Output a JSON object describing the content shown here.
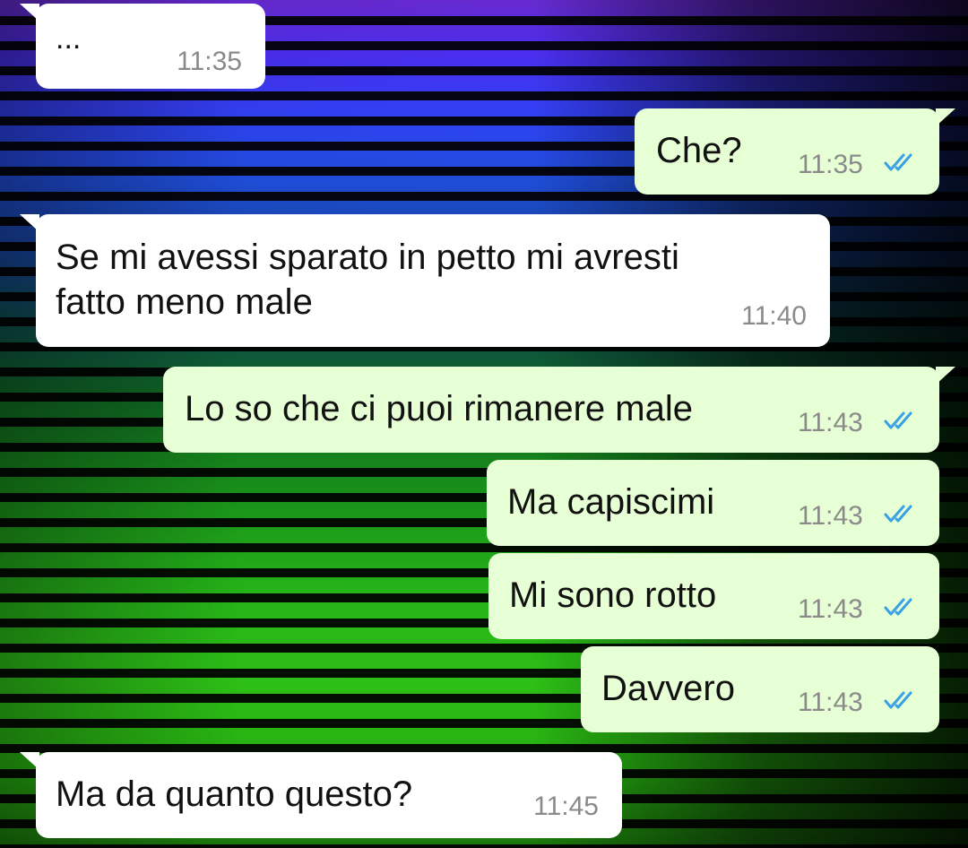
{
  "colors": {
    "incoming_bubble": "#ffffff",
    "outgoing_bubble": "#e6ffd4",
    "text": "#111111",
    "time": "#8a8a8a",
    "read_ticks": "#3aa0e8"
  },
  "messages": [
    {
      "direction": "in",
      "text": "...",
      "time": "11:35"
    },
    {
      "direction": "out",
      "text": "Che?",
      "time": "11:35",
      "status": "read",
      "status_icon": "double-check-icon"
    },
    {
      "direction": "in",
      "text": "Se mi avessi sparato in petto mi avresti\nfatto meno male",
      "time": "11:40"
    },
    {
      "direction": "out",
      "text": "Lo so che ci puoi rimanere male",
      "time": "11:43",
      "status": "read",
      "status_icon": "double-check-icon"
    },
    {
      "direction": "out",
      "text": "Ma capiscimi",
      "time": "11:43",
      "status": "read",
      "status_icon": "double-check-icon"
    },
    {
      "direction": "out",
      "text": "Mi sono rotto",
      "time": "11:43",
      "status": "read",
      "status_icon": "double-check-icon"
    },
    {
      "direction": "out",
      "text": "Davvero",
      "time": "11:43",
      "status": "read",
      "status_icon": "double-check-icon"
    },
    {
      "direction": "in",
      "text": "Ma da quanto questo?",
      "time": "11:45"
    }
  ]
}
